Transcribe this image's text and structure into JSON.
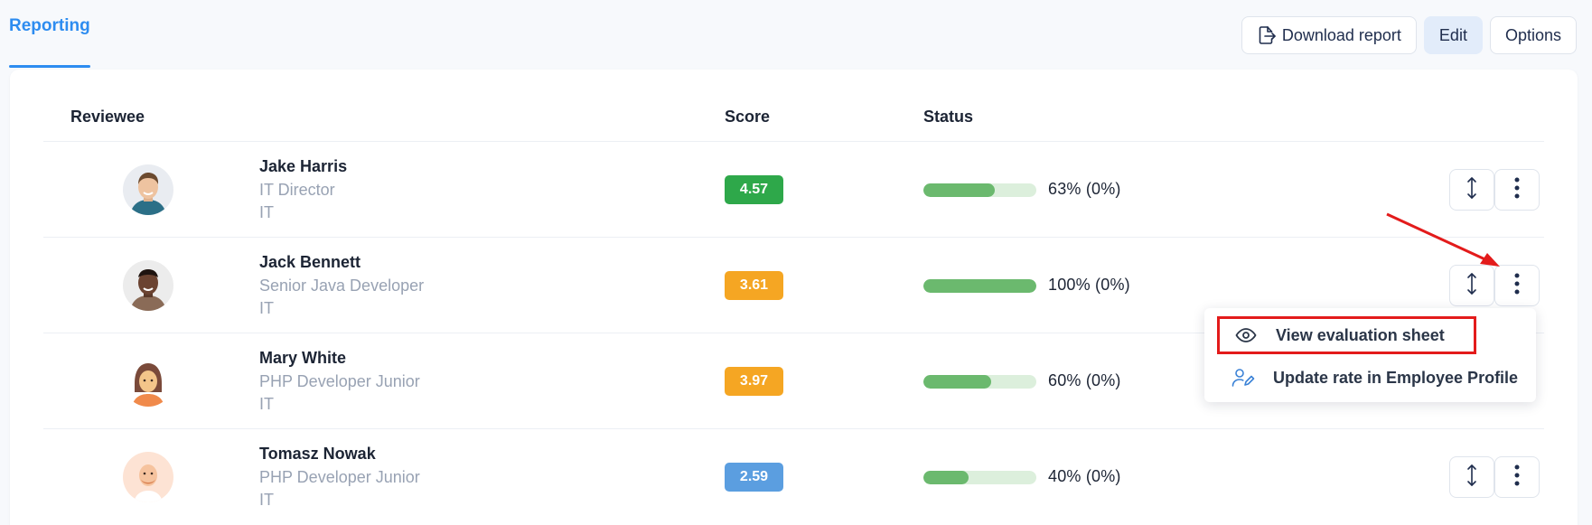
{
  "tab": {
    "label": "Reporting"
  },
  "toolbar": {
    "download_label": "Download report",
    "edit_label": "Edit",
    "options_label": "Options"
  },
  "table": {
    "headers": {
      "reviewee": "Reviewee",
      "score": "Score",
      "status": "Status"
    },
    "rows": [
      {
        "name": "Jake Harris",
        "role": "IT Director",
        "dept": "IT",
        "score": "4.57",
        "score_color": "#2ea84a",
        "progress": 0.63,
        "progress_text": "63%  (0%)"
      },
      {
        "name": "Jack Bennett",
        "role": "Senior Java Developer",
        "dept": "IT",
        "score": "3.61",
        "score_color": "#f5a623",
        "progress": 1.0,
        "progress_text": "100%  (0%)"
      },
      {
        "name": "Mary White",
        "role": "PHP Developer Junior",
        "dept": "IT",
        "score": "3.97",
        "score_color": "#f5a623",
        "progress": 0.6,
        "progress_text": "60%  (0%)"
      },
      {
        "name": "Tomasz Nowak",
        "role": "PHP Developer Junior",
        "dept": "IT",
        "score": "2.59",
        "score_color": "#5b9ee0",
        "progress": 0.4,
        "progress_text": "40%  (0%)"
      }
    ]
  },
  "menu": {
    "items": [
      {
        "label": "View evaluation sheet",
        "icon": "eye-icon"
      },
      {
        "label": "Update rate in Employee Profile",
        "icon": "user-edit-icon"
      }
    ]
  },
  "annotation": {
    "highlight_color": "#e31b1b"
  }
}
